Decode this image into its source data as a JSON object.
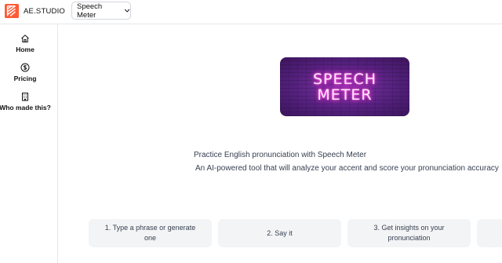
{
  "header": {
    "logo_text": "AE.STUDIO",
    "logo_icon": "ae-studio-logo-icon",
    "app_select": {
      "selected": "Speech Meter",
      "icon": "chevron-down-icon"
    }
  },
  "sidebar": {
    "items": [
      {
        "label": "Home",
        "icon": "home-icon"
      },
      {
        "label": "Pricing",
        "icon": "dollar-circle-icon"
      },
      {
        "label": "Who made this?",
        "icon": "building-icon"
      }
    ]
  },
  "hero": {
    "line1": "SPEECH",
    "line2": "METER"
  },
  "main": {
    "tagline": "Practice English pronunciation with Speech Meter",
    "subtagline": "An AI-powered tool that will analyze your accent and score your pronunciation accuracy",
    "steps": [
      {
        "label": "1. Type a phrase or generate one"
      },
      {
        "label": "2. Say it"
      },
      {
        "label": "3. Get insights on your pronunciation"
      }
    ]
  },
  "colors": {
    "brand": "#ff5a36",
    "hero_bg": "#55217e",
    "neon": "#ff3fd8",
    "card_bg": "#f3f4f6"
  }
}
